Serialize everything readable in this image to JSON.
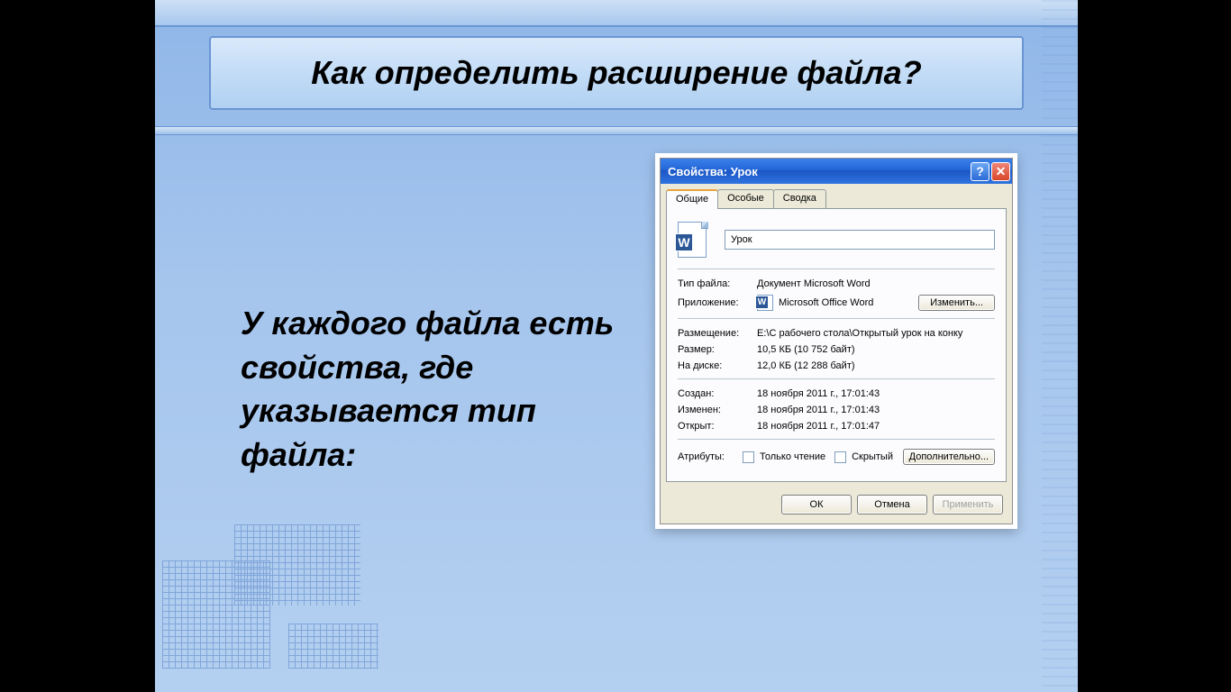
{
  "slide": {
    "title": "Как определить расширение файла?",
    "body_text": "У каждого файла есть свойства, где указывается тип файла:"
  },
  "dialog": {
    "window_title": "Свойства: Урок",
    "tabs": [
      "Общие",
      "Особые",
      "Сводка"
    ],
    "filename": "Урок",
    "rows": {
      "file_type_label": "Тип файла:",
      "file_type_value": "Документ Microsoft Word",
      "app_label": "Приложение:",
      "app_value": "Microsoft Office Word",
      "change_btn": "Изменить...",
      "location_label": "Размещение:",
      "location_value": "E:\\С рабочего стола\\Открытый урок на конку",
      "size_label": "Размер:",
      "size_value": "10,5 КБ (10 752 байт)",
      "ondisk_label": "На диске:",
      "ondisk_value": "12,0 КБ (12 288 байт)",
      "created_label": "Создан:",
      "created_value": "18 ноября 2011 г., 17:01:43",
      "modified_label": "Изменен:",
      "modified_value": "18 ноября 2011 г., 17:01:43",
      "opened_label": "Открыт:",
      "opened_value": "18 ноября 2011 г., 17:01:47",
      "attrs_label": "Атрибуты:",
      "readonly_label": "Только чтение",
      "hidden_label": "Скрытый",
      "advanced_btn": "Дополнительно..."
    },
    "buttons": {
      "ok": "ОК",
      "cancel": "Отмена",
      "apply": "Применить"
    }
  }
}
